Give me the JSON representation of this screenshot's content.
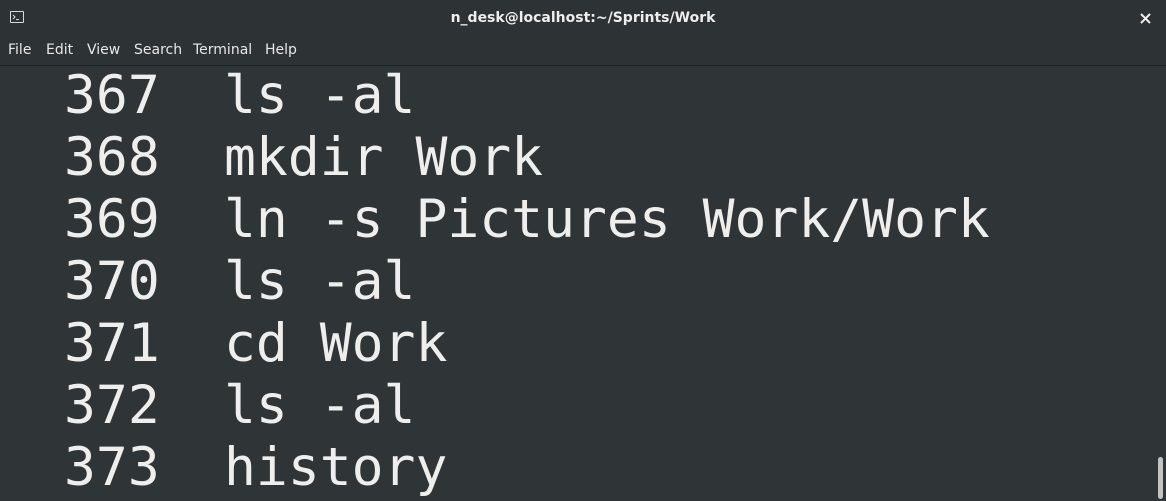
{
  "window": {
    "title": "n_desk@localhost:~/Sprints/Work"
  },
  "icons": {
    "app": "terminal-icon",
    "close": "close-icon"
  },
  "menu": [
    {
      "label": "File"
    },
    {
      "label": "Edit"
    },
    {
      "label": "View"
    },
    {
      "label": "Search"
    },
    {
      "label": "Terminal"
    },
    {
      "label": "Help"
    }
  ],
  "history": [
    {
      "num": "367",
      "cmd": "ls -al"
    },
    {
      "num": "368",
      "cmd": "mkdir Work"
    },
    {
      "num": "369",
      "cmd": "ln -s Pictures Work/Work"
    },
    {
      "num": "370",
      "cmd": "ls -al"
    },
    {
      "num": "371",
      "cmd": "cd Work"
    },
    {
      "num": "372",
      "cmd": "ls -al"
    },
    {
      "num": "373",
      "cmd": "history"
    }
  ],
  "colors": {
    "background": "#2f3436",
    "text": "#eeeeec",
    "chrome": "#2d3234"
  }
}
